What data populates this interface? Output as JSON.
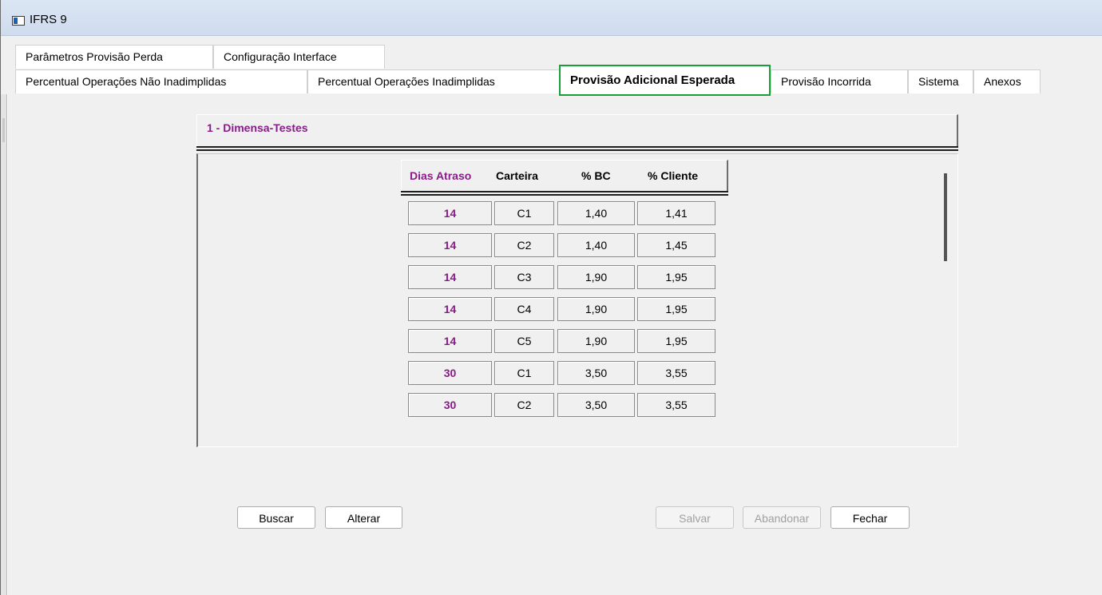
{
  "window": {
    "title": "IFRS 9"
  },
  "tabs_row1": [
    {
      "label": "Parâmetros Provisão Perda"
    },
    {
      "label": "Configuração Interface"
    }
  ],
  "tabs_row2": [
    {
      "label": "Percentual Operações Não Inadimplidas"
    },
    {
      "label": "Percentual Operações Inadimplidas"
    },
    {
      "label": "Provisão Adicional Esperada",
      "active": true
    },
    {
      "label": "Provisão Incorrida"
    },
    {
      "label": "Sistema"
    },
    {
      "label": "Anexos"
    }
  ],
  "group": {
    "title": "1 - Dimensa-Testes"
  },
  "table": {
    "headers": [
      "Dias Atraso",
      "Carteira",
      "% BC",
      "% Cliente"
    ],
    "rows": [
      [
        "14",
        "C1",
        "1,40",
        "1,41"
      ],
      [
        "14",
        "C2",
        "1,40",
        "1,45"
      ],
      [
        "14",
        "C3",
        "1,90",
        "1,95"
      ],
      [
        "14",
        "C4",
        "1,90",
        "1,95"
      ],
      [
        "14",
        "C5",
        "1,90",
        "1,95"
      ],
      [
        "30",
        "C1",
        "3,50",
        "3,55"
      ],
      [
        "30",
        "C2",
        "3,50",
        "3,55"
      ]
    ]
  },
  "buttons": {
    "buscar": "Buscar",
    "alterar": "Alterar",
    "salvar": "Salvar",
    "abandonar": "Abandonar",
    "fechar": "Fechar"
  },
  "colors": {
    "accent_tab_border": "#1a9e3a",
    "label_purple": "#8b1a8b"
  },
  "icons": {
    "window_icon": "app-window-icon"
  }
}
